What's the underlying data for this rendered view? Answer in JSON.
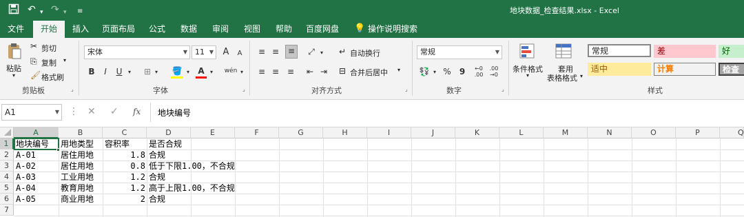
{
  "titlebar": {
    "title": "地块数据_检查结果.xlsx  -  Excel",
    "save_icon": "save-icon",
    "undo_icon": "undo-icon",
    "redo_icon": "redo-icon",
    "customize_icon": "customize-quick-access-icon"
  },
  "tabs": [
    "文件",
    "开始",
    "插入",
    "页面布局",
    "公式",
    "数据",
    "审阅",
    "视图",
    "帮助",
    "百度网盘"
  ],
  "active_tab": "开始",
  "tell_me": "操作说明搜索",
  "ribbon": {
    "clipboard": {
      "paste": "粘贴",
      "cut": "剪切",
      "copy": "复制",
      "format_painter": "格式刷",
      "group": "剪贴板"
    },
    "font": {
      "name": "宋体",
      "size": "11",
      "group": "字体",
      "bold": "B",
      "italic": "I",
      "underline": "U",
      "grow": "A",
      "shrink": "A",
      "font_color_glyph": "A",
      "phonetic_glyph": "wén"
    },
    "alignment": {
      "wrap": "自动换行",
      "merge": "合并后居中",
      "group": "对齐方式"
    },
    "number": {
      "format": "常规",
      "group": "数字",
      "percent": "%",
      "comma": "9"
    },
    "styles": {
      "conditional": "条件格式",
      "table_l1": "套用",
      "table_l2": "表格格式",
      "normal": "常规",
      "bad": "差",
      "good": "好",
      "neutral": "适中",
      "calculation": "计算",
      "check_cell": "检查单",
      "group": "样式"
    }
  },
  "formula_bar": {
    "name_box": "A1",
    "fx": "fx",
    "content": "地块编号"
  },
  "colors": {
    "accent": "#217346",
    "bad_bg": "#ffc7ce",
    "bad_fg": "#9c0006",
    "good_bg": "#c6efce",
    "good_fg": "#006100",
    "neutral_bg": "#ffeb9c",
    "neutral_fg": "#9c5700",
    "calc_bg": "#f2f2f2",
    "calc_fg": "#fa7d00",
    "check_bg": "#a5a5a5"
  },
  "sheet": {
    "columns": [
      "A",
      "B",
      "C",
      "D",
      "E",
      "F",
      "G",
      "H",
      "I",
      "J",
      "K",
      "L",
      "M",
      "N",
      "O",
      "P",
      "Q"
    ],
    "rows": [
      "1",
      "2",
      "3",
      "4",
      "5",
      "6",
      "7"
    ],
    "headers": [
      "地块编号",
      "用地类型",
      "容积率",
      "是否合规"
    ],
    "data": [
      [
        "A-01",
        "居住用地",
        "1.8",
        "合规"
      ],
      [
        "A-02",
        "居住用地",
        "0.8",
        "低于下限1.00，不合规"
      ],
      [
        "A-03",
        "工业用地",
        "1.2",
        "合规"
      ],
      [
        "A-04",
        "教育用地",
        "1.2",
        "高于上限1.00，不合规"
      ],
      [
        "A-05",
        "商业用地",
        "2",
        "合规"
      ]
    ]
  }
}
